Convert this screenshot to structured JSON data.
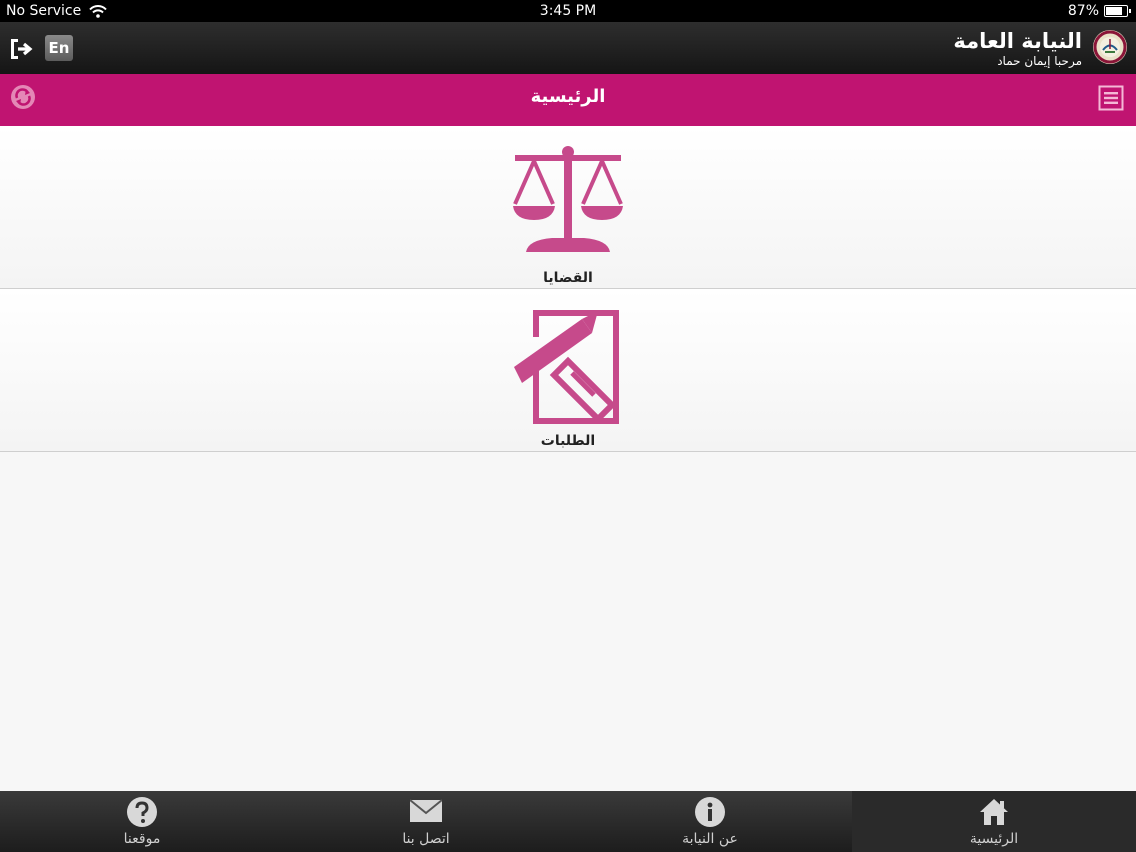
{
  "status_bar": {
    "carrier": "No Service",
    "time": "3:45 PM",
    "battery": "87%",
    "battery_level": 0.87
  },
  "header": {
    "title": "النيابة العامة",
    "subtitle": "مرحبا إيمان حماد",
    "lang_label": "En"
  },
  "title_bar": {
    "title": "الرئيسية"
  },
  "items": [
    {
      "label": "القضايا",
      "icon": "scales-icon"
    },
    {
      "label": "الطلبات",
      "icon": "document-pen-icon"
    }
  ],
  "tabs": [
    {
      "label": "موقعنا",
      "icon": "question-icon"
    },
    {
      "label": "اتصل بنا",
      "icon": "envelope-icon"
    },
    {
      "label": "عن النيابة",
      "icon": "info-icon"
    },
    {
      "label": "الرئيسية",
      "icon": "home-icon",
      "active": true
    }
  ],
  "colors": {
    "accent": "#c01471",
    "icon": "#c64a8b",
    "header": "#1a1a1a",
    "tabbar": "#2a2a2a"
  }
}
